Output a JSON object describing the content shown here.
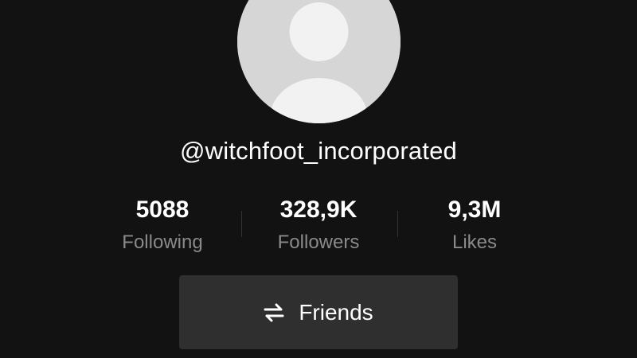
{
  "profile": {
    "username": "@witchfoot_incorporated",
    "avatar_icon": "default-user-avatar-icon"
  },
  "stats": {
    "following": {
      "value": "5088",
      "label": "Following"
    },
    "followers": {
      "value": "328,9K",
      "label": "Followers"
    },
    "likes": {
      "value": "9,3M",
      "label": "Likes"
    }
  },
  "actions": {
    "friends_label": "Friends",
    "friends_icon": "swap-arrows-icon"
  },
  "colors": {
    "background": "#121212",
    "text_primary": "#ffffff",
    "text_secondary": "#8a8a8a",
    "button_bg": "#2f2f2f",
    "avatar_bg": "#d6d6d6"
  }
}
